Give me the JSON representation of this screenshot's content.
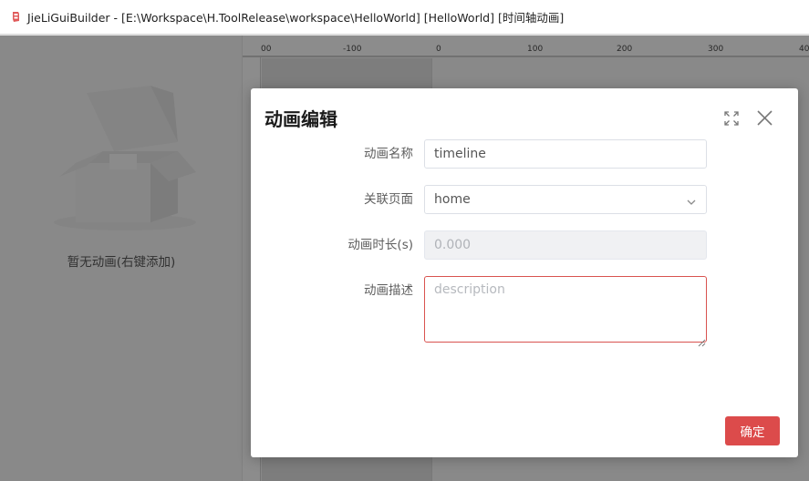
{
  "window": {
    "title": "JieLiGuiBuilder - [E:\\Workspace\\H.ToolRelease\\workspace\\HelloWorld] [HelloWorld] [时间轴动画]",
    "icon": "app-logo-icon"
  },
  "left_panel": {
    "empty_text": "暂无动画(右键添加)",
    "icon": "empty-box-icon"
  },
  "ruler": {
    "labels": [
      "00",
      "-100",
      "0",
      "100",
      "200",
      "300",
      "40"
    ]
  },
  "dialog": {
    "title": "动画编辑",
    "fullscreen_icon": "fullscreen-icon",
    "close_icon": "close-icon",
    "fields": {
      "name": {
        "label": "动画名称",
        "value": "timeline"
      },
      "page": {
        "label": "关联页面",
        "value": "home"
      },
      "duration": {
        "label": "动画时长(s)",
        "value": "0.000"
      },
      "description": {
        "label": "动画描述",
        "placeholder": "description",
        "value": ""
      }
    },
    "confirm_label": "确定"
  },
  "colors": {
    "accent": "#dc4b4b",
    "textarea_border": "#d9534f",
    "overlay": "rgba(0,0,0,0.42)"
  }
}
